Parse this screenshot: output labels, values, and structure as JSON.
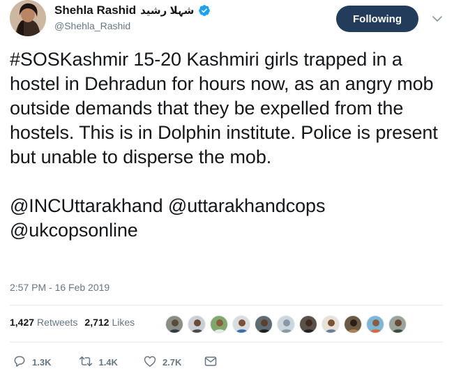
{
  "author": {
    "display_name": "Shehla Rashid",
    "urdu_name": "شہلا رشید",
    "handle": "@Shehla_Rashid",
    "verified": true,
    "verified_icon": "verified-badge-icon"
  },
  "follow_button": {
    "label": "Following"
  },
  "menu": {
    "icon": "chevron-down-icon"
  },
  "tweet": {
    "paragraph1": "#SOSKashmir 15-20 Kashmiri girls trapped in a hostel in Dehradun for hours now, as an angry mob outside demands that they be expelled from the hostels. This is in Dolphin institute. Police is present but unable to disperse the mob.",
    "paragraph2": "@INCUttarakhand @uttarakhandcops @ukcopsonline"
  },
  "timestamp": "2:57 PM - 16 Feb 2019",
  "stats": {
    "retweets_count": "1,427",
    "retweets_label": "Retweets",
    "likes_count": "2,712",
    "likes_label": "Likes"
  },
  "actions": {
    "reply_count": "1.3K",
    "retweet_count": "1.4K",
    "like_count": "2.7K",
    "reply_icon": "reply-icon",
    "retweet_icon": "retweet-icon",
    "like_icon": "heart-icon",
    "dm_icon": "envelope-icon"
  },
  "colors": {
    "follow_bg": "#233c5c",
    "verified_blue": "#1da1f2",
    "muted_text": "#657786",
    "divider": "#e6ecf0"
  }
}
